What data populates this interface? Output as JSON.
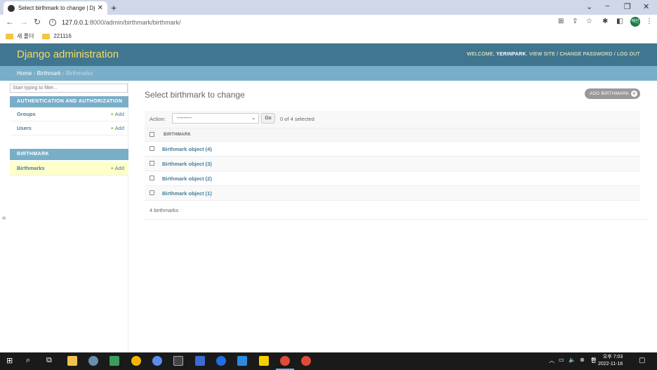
{
  "browser": {
    "tab_title": "Select birthmark to change | Dj",
    "url_host": "127.0.0.1",
    "url_rest": ":8000/admin/birthmark/birthmark/",
    "bookmarks": [
      "새 폴더",
      "221116"
    ],
    "profile_badge": "예린"
  },
  "header": {
    "branding": "Django administration",
    "welcome": "WELCOME,",
    "username": "YERINPARK",
    "links": ". VIEW SITE / CHANGE PASSWORD / LOG OUT"
  },
  "breadcrumbs": {
    "home": "Home",
    "sep1": " › ",
    "app": "Birthmark",
    "sep2": " › ",
    "current": "Birthmarks"
  },
  "sidebar": {
    "filter_placeholder": "Start typing to filter...",
    "modules": [
      {
        "caption": "AUTHENTICATION AND AUTHORIZATION",
        "rows": [
          {
            "label": "Groups",
            "add": "Add"
          },
          {
            "label": "Users",
            "add": "Add"
          }
        ]
      },
      {
        "caption": "BIRTHMARK",
        "rows": [
          {
            "label": "Birthmarks",
            "add": "Add"
          }
        ]
      }
    ],
    "collapse": "«"
  },
  "content": {
    "title": "Select birthmark to change",
    "add_button": "ADD BIRTHMARK",
    "action_label": "Action:",
    "action_selected": "---------",
    "go_label": "Go",
    "selected_count": "0 of 4 selected",
    "column_header": "BIRTHMARK",
    "rows": [
      "Birthmark object (4)",
      "Birthmark object (3)",
      "Birthmark object (2)",
      "Birthmark object (1)"
    ],
    "paginator": "4 birthmarks"
  },
  "taskbar": {
    "time": "오후 7:03",
    "date": "2022-11-16",
    "ime": "한"
  },
  "colors": {
    "header_bg": "#417690",
    "branding": "#f5dd5d",
    "breadcrumbs_bg": "#79aec8",
    "link": "#447e9b",
    "add_green": "#70bf2b",
    "current_row": "#ffffcc"
  }
}
